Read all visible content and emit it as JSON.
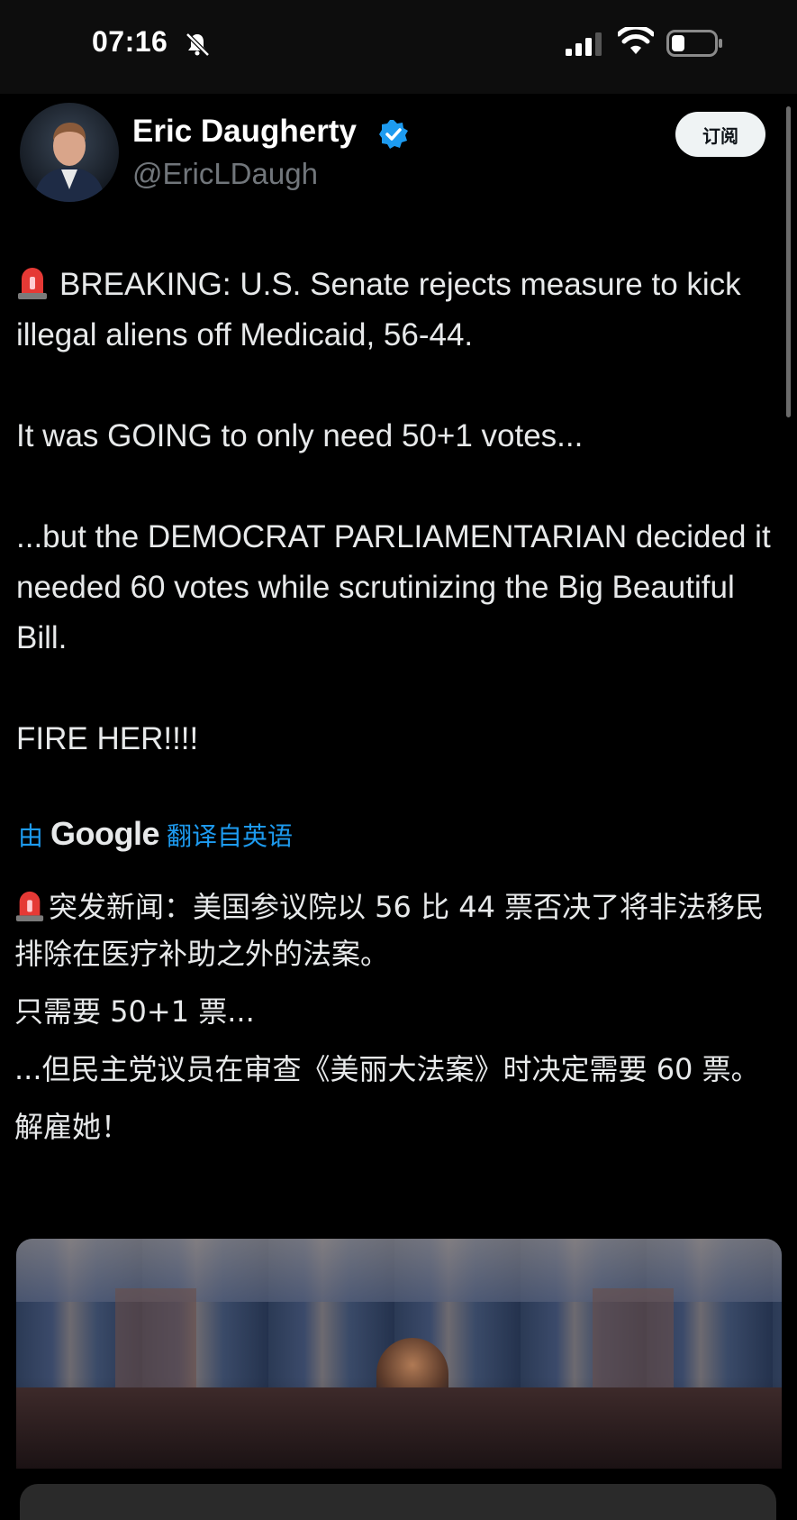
{
  "status_bar": {
    "time": "07:16",
    "icons": [
      "bell-slash-icon",
      "cellular-signal-icon",
      "wifi-icon",
      "battery-icon"
    ]
  },
  "tweet": {
    "display_name": "Eric Daugherty",
    "handle": "@EricLDaugh",
    "verified_icon": "verified-badge-icon",
    "subscribe_label": "订阅",
    "body": {
      "line1": "BREAKING: U.S. Senate rejects measure to kick illegal aliens off Medicaid, 56-44.",
      "line2": "It was GOING to only need 50+1 votes...",
      "line3": "...but the DEMOCRAT PARLIAMENTARIAN decided it needed 60 votes while scrutinizing the Big Beautiful Bill.",
      "line4": "FIRE HER!!!!"
    },
    "translation_note": {
      "prefix": "由",
      "provider": "Google",
      "suffix": "翻译自英语"
    },
    "translation": {
      "p1": "突发新闻：美国参议院以 56 比 44 票否决了将非法移民排除在医疗补助之外的法案。",
      "p2": "只需要 50+1 票...",
      "p3": "...但民主党议员在审查《美丽大法案》时决定需要 60 票。",
      "p4": "解雇她！"
    }
  },
  "colors": {
    "background": "#000000",
    "text": "#e7e9ea",
    "secondary": "#71767b",
    "link": "#1d9bf0",
    "verified": "#1d9bf0"
  }
}
